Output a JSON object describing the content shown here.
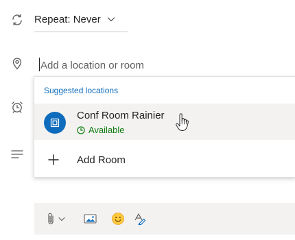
{
  "repeat": {
    "label": "Repeat: Never"
  },
  "location": {
    "placeholder": "Add a location or room",
    "value": ""
  },
  "suggestions": {
    "header": "Suggested locations",
    "items": [
      {
        "name": "Conf Room Rainier",
        "status": "Available",
        "icon": "room-icon"
      }
    ],
    "add_label": "Add Room"
  },
  "left_icons": [
    "repeat-icon",
    "location-pin-icon",
    "alarm-clock-icon",
    "notes-lines-icon"
  ],
  "toolbar": {
    "icons": [
      "paperclip-icon",
      "chevron-down-icon",
      "image-icon",
      "emoji-icon",
      "format-painter-icon"
    ]
  },
  "colors": {
    "accent": "#0f6cbd",
    "available": "#107c10",
    "hover_bg": "#f3f2f1",
    "text": "#252423"
  }
}
